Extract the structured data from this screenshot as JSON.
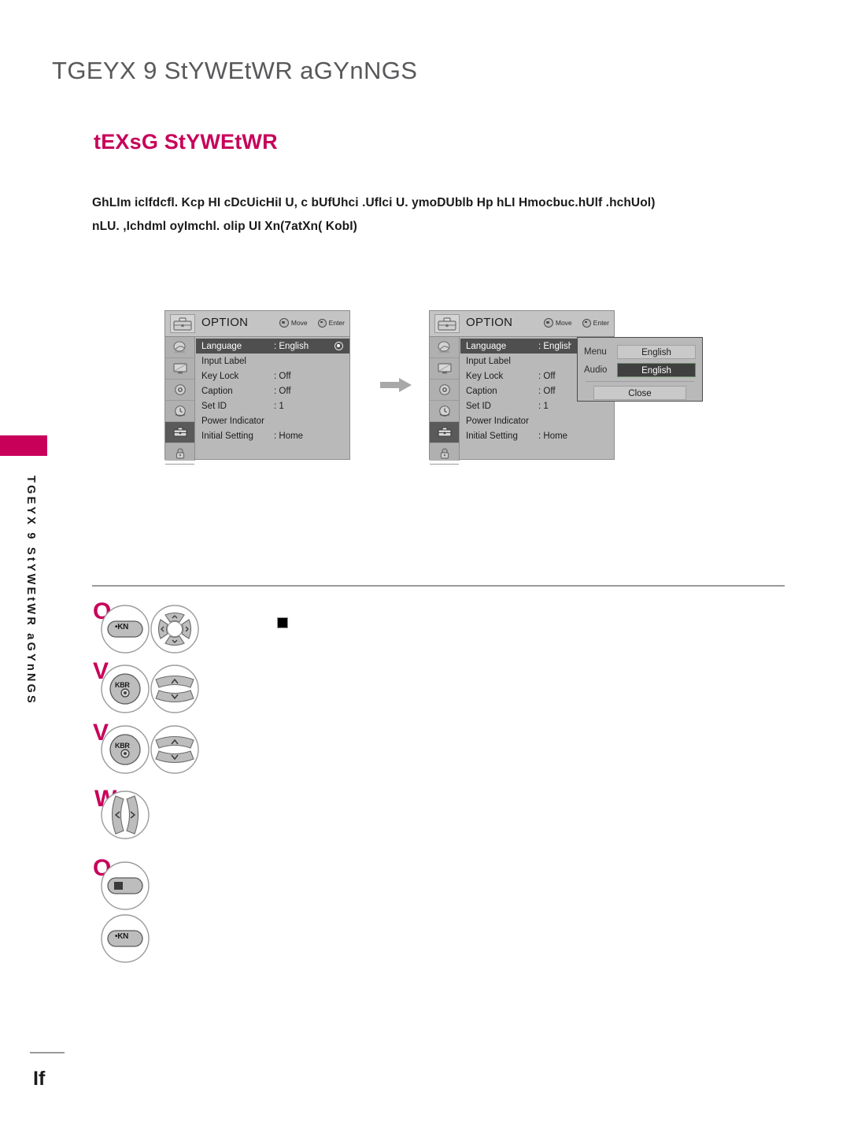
{
  "page": {
    "title": "TGEYX 9 StYWEtWR aGYnNGS",
    "section_title": "tEXsG StYWEtWR",
    "body_lines": [
      "GhLIm iclfdcfl. Kcp HI cDcUicHiI U, c bUfUhci .Uflci U. ymoDUblb Hp hLI Hmocbuc.hUlf .hchUol)",
      "nLU. ,Ichdml oyImchl. olip UI Xn(7atXn( KobI)"
    ],
    "side_label": "TGEYX 9 StYWEtWR aGYnNGS",
    "footer_number": "If",
    "accent_color": "#c8005a",
    "title_color": "#58595b"
  },
  "osd": {
    "header": {
      "title": "OPTION",
      "move_label": "Move",
      "enter_label": "Enter",
      "icon_name": "option-toolbox-icon"
    },
    "icon_column": [
      {
        "name": "picture-icon"
      },
      {
        "name": "screen-icon"
      },
      {
        "name": "audio-icon"
      },
      {
        "name": "time-icon"
      },
      {
        "name": "option-icon",
        "active": true
      },
      {
        "name": "lock-icon"
      }
    ],
    "rows": [
      {
        "label": "Language",
        "value": ": English",
        "selected": true,
        "radio": true
      },
      {
        "label": "Input Label",
        "value": "",
        "selected": false,
        "radio": false
      },
      {
        "label": "Key Lock",
        "value": ": Off",
        "selected": false,
        "radio": false
      },
      {
        "label": "Caption",
        "value": ": Off",
        "selected": false,
        "radio": false
      },
      {
        "label": "Set ID",
        "value": ": 1",
        "selected": false,
        "radio": false
      },
      {
        "label": "Power Indicator",
        "value": "",
        "selected": false,
        "radio": false
      },
      {
        "label": "Initial Setting",
        "value": ": Home",
        "selected": false,
        "radio": false
      }
    ]
  },
  "language_popup": {
    "menu_label": "Menu",
    "menu_value": "English",
    "audio_label": "Audio",
    "audio_value": "English",
    "close_label": "Close"
  },
  "steps": [
    {
      "marker": "O",
      "button_label": "•KN",
      "pad": "dpad-4way"
    },
    {
      "marker": "V",
      "button_label": "KBR",
      "pad": "updown-rocker"
    },
    {
      "marker": "V",
      "button_label": "KBR",
      "pad": "updown-rocker"
    },
    {
      "marker": "W",
      "button_label": "",
      "pad": "leftright-rocker"
    },
    {
      "marker": "O",
      "button_label": "▉",
      "pad": "none"
    },
    {
      "marker": "",
      "button_label": "•KN",
      "pad": "none"
    }
  ]
}
